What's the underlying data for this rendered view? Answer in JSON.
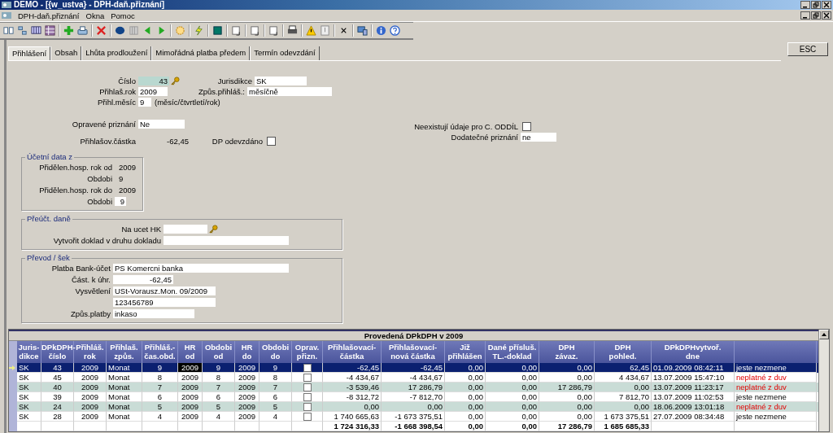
{
  "window": {
    "title": "DEMO - [{w_ustva} - DPH-daň.přiznání]"
  },
  "menu": [
    "DPH-daň.přiznání",
    "Okna",
    "Pomoc"
  ],
  "esc_button": "ESC",
  "tabs": [
    {
      "label": "Přihlášení",
      "selected": true
    },
    {
      "label": "Obsah",
      "selected": false
    },
    {
      "label": "Lhůta prodloužení",
      "selected": false
    },
    {
      "label": "Mimořádná platba předem",
      "selected": false
    },
    {
      "label": "Termín odevzdání",
      "selected": false
    }
  ],
  "header": {
    "cislo": {
      "label": "Číslo",
      "value": "43"
    },
    "jurisdikce": {
      "label": "Jurisdikce",
      "value": "SK"
    },
    "rok": {
      "label": "Přihlaš.rok",
      "value": "2009"
    },
    "zpusob": {
      "label": "Způs.přihláš.:",
      "value": "měsíčně"
    },
    "mesic": {
      "label": "Přihl.měsíc",
      "value": "9",
      "hint": "(měsíc/čtvrtletí/rok)"
    },
    "opravene": {
      "label": "Opravené priznání",
      "value": "Ne"
    },
    "castka": {
      "label": "Přihlašov.částka",
      "value": "-62,45"
    },
    "dp_odevzdano": {
      "label": "DP odevzdáno",
      "checked": false
    },
    "neexistuji": {
      "label": "Neexistují údaje pro C. ODDÍL",
      "checked": false
    },
    "dodatecne": {
      "label": "Dodatečné priznání",
      "value": "ne"
    }
  },
  "ucetni_data": {
    "title": "Účetní data z",
    "rows": [
      {
        "label": "Přidělen.hosp. rok od",
        "value": "2009",
        "kind": "text"
      },
      {
        "label": "Obdobi",
        "value": "9",
        "kind": "text"
      },
      {
        "label": "Přidělen.hosp. rok do",
        "value": "2009",
        "kind": "text"
      },
      {
        "label": "Obdobi",
        "value": "9",
        "kind": "field"
      }
    ]
  },
  "preuct": {
    "title": "Přeúčt. daně",
    "na_ucet": {
      "label": "Na ucet HK"
    },
    "vytvorit": {
      "label": "Vytvořit doklad v druhu dokladu"
    }
  },
  "prevod": {
    "title": "Převod / šek",
    "rows": [
      {
        "label": "Platba Bank-účet",
        "value": "PS Komercni banka",
        "kind": "wide"
      },
      {
        "label": "Část. k úhr.",
        "value": "-62,45",
        "kind": "amount"
      },
      {
        "label": "Vysvětlení",
        "value": "USt-Vorausz.Mon. 09/2009",
        "kind": "mid"
      },
      {
        "value": "123456789",
        "kind": "mid"
      },
      {
        "label": "Způs.platby",
        "value": "inkaso",
        "kind": "short"
      }
    ]
  },
  "table": {
    "title": "Provedená DPkDPH v 2009",
    "columns": [
      {
        "label": "Juris-\ndikce",
        "kind": "text"
      },
      {
        "label": "DPkDPH-\nčíslo",
        "kind": "center"
      },
      {
        "label": "Přihláš.\nrok",
        "kind": "center"
      },
      {
        "label": "Přihlaš.\nzpůs.",
        "kind": "text"
      },
      {
        "label": "Přihláš.-\nčas.obd.",
        "kind": "center"
      },
      {
        "label": "HR\nod",
        "kind": "center",
        "focused": true
      },
      {
        "label": "Obdobi\nod",
        "kind": "center"
      },
      {
        "label": "HR\ndo",
        "kind": "center"
      },
      {
        "label": "Obdobi\ndo",
        "kind": "center"
      },
      {
        "label": "Oprav.\npřizn.",
        "kind": "check"
      },
      {
        "label": "Přihlašovací-\nčástka",
        "kind": "number"
      },
      {
        "label": "Přihlašovací-\nnová částka",
        "kind": "number"
      },
      {
        "label": "Již\npřihlášen",
        "kind": "number"
      },
      {
        "label": "Dané přísluš.\nTL.-doklad",
        "kind": "number"
      },
      {
        "label": "DPH\nzávaz.",
        "kind": "number"
      },
      {
        "label": "DPH\npohled.",
        "kind": "number"
      },
      {
        "label": "DPkDPHvytvoř.\ndne",
        "kind": "text"
      },
      {
        "kind": "note"
      }
    ],
    "rows": [
      {
        "selected": true,
        "kind": "pending",
        "cells": [
          "SK",
          "43",
          "2009",
          "Monat",
          "9",
          "2009",
          "9",
          "2009",
          "9",
          false,
          "-62,45",
          "-62,45",
          "0,00",
          "0,00",
          "0,00",
          "62,45",
          "01.09.2009 08:42:11",
          "jeste nezmene"
        ]
      },
      {
        "selected": false,
        "kind": "invalid",
        "cells": [
          "SK",
          "45",
          "2009",
          "Monat",
          "8",
          "2009",
          "8",
          "2009",
          "8",
          false,
          "-4 434,67",
          "-4 434,67",
          "0,00",
          "0,00",
          "0,00",
          "4 434,67",
          "13.07.2009 15:47:10",
          "neplatné z duv"
        ]
      },
      {
        "selected": false,
        "kind": "invalid",
        "cells": [
          "SK",
          "40",
          "2009",
          "Monat",
          "7",
          "2009",
          "7",
          "2009",
          "7",
          false,
          "-3 539,46",
          "17 286,79",
          "0,00",
          "0,00",
          "17 286,79",
          "0,00",
          "13.07.2009 11:23:17",
          "neplatné z duv"
        ]
      },
      {
        "selected": false,
        "kind": "pending",
        "cells": [
          "SK",
          "39",
          "2009",
          "Monat",
          "6",
          "2009",
          "6",
          "2009",
          "6",
          false,
          "-8 312,72",
          "-7 812,70",
          "0,00",
          "0,00",
          "0,00",
          "7 812,70",
          "13.07.2009 11:02:53",
          "jeste nezmene"
        ]
      },
      {
        "selected": false,
        "kind": "invalid",
        "cells": [
          "SK",
          "24",
          "2009",
          "Monat",
          "5",
          "2009",
          "5",
          "2009",
          "5",
          false,
          "0,00",
          "0,00",
          "0,00",
          "0,00",
          "0,00",
          "0,00",
          "18.06.2009 13:01:18",
          "neplatné z duv"
        ]
      },
      {
        "selected": false,
        "kind": "pending",
        "cells": [
          "SK",
          "28",
          "2009",
          "Monat",
          "4",
          "2009",
          "4",
          "2009",
          "4",
          false,
          "1 740 665,63",
          "-1 673 375,51",
          "0,00",
          "0,00",
          "0,00",
          "1 673 375,51",
          "27.07.2009 08:34:48",
          "jeste nezmene"
        ]
      }
    ],
    "totals": [
      "1 724 316,33",
      "-1 668 398,54",
      "0,00",
      "0,00",
      "17 286,79",
      "1 685 685,33"
    ]
  }
}
